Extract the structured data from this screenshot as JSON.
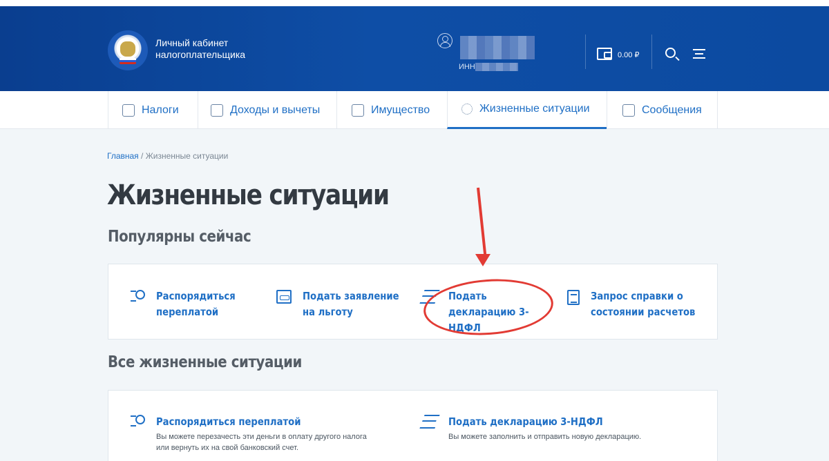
{
  "header": {
    "brand_line1": "Личный кабинет",
    "brand_line2": "налогоплательщика",
    "inn_label": "ИНН",
    "balance": "0.00 ₽"
  },
  "nav": [
    {
      "label": "Налоги",
      "icon": "tax-icon"
    },
    {
      "label": "Доходы и вычеты",
      "icon": "income-icon"
    },
    {
      "label": "Имущество",
      "icon": "property-icon"
    },
    {
      "label": "Жизненные ситуации",
      "icon": "life-situations-icon",
      "active": true
    },
    {
      "label": "Сообщения",
      "icon": "messages-icon"
    }
  ],
  "breadcrumb": {
    "home": "Главная",
    "sep": " / ",
    "current": "Жизненные ситуации"
  },
  "page_title": "Жизненные ситуации",
  "popular": {
    "heading": "Популярны сейчас",
    "items": [
      {
        "label": "Распорядиться переплатой",
        "icon": "ruble-coin-icon"
      },
      {
        "label": "Подать заявление на льготу",
        "icon": "document-icon"
      },
      {
        "label": "Подать декларацию 3-НДФЛ",
        "icon": "money-stack-icon"
      },
      {
        "label": "Запрос справки о состоянии расчетов",
        "icon": "list-document-icon"
      }
    ]
  },
  "all": {
    "heading": "Все жизненные ситуации",
    "items": [
      {
        "title": "Распорядиться переплатой",
        "desc": "Вы можете перезачесть эти деньги в оплату другого налога или вернуть их на свой банковский счет.",
        "icon": "ruble-coin-icon"
      },
      {
        "title": "Подать декларацию 3-НДФЛ",
        "desc": "Вы можете заполнить и отправить новую декларацию.",
        "icon": "money-stack-icon"
      }
    ]
  },
  "colors": {
    "header": "#0e4ea6",
    "link": "#1f6fc5",
    "annotation": "#e23b34"
  }
}
